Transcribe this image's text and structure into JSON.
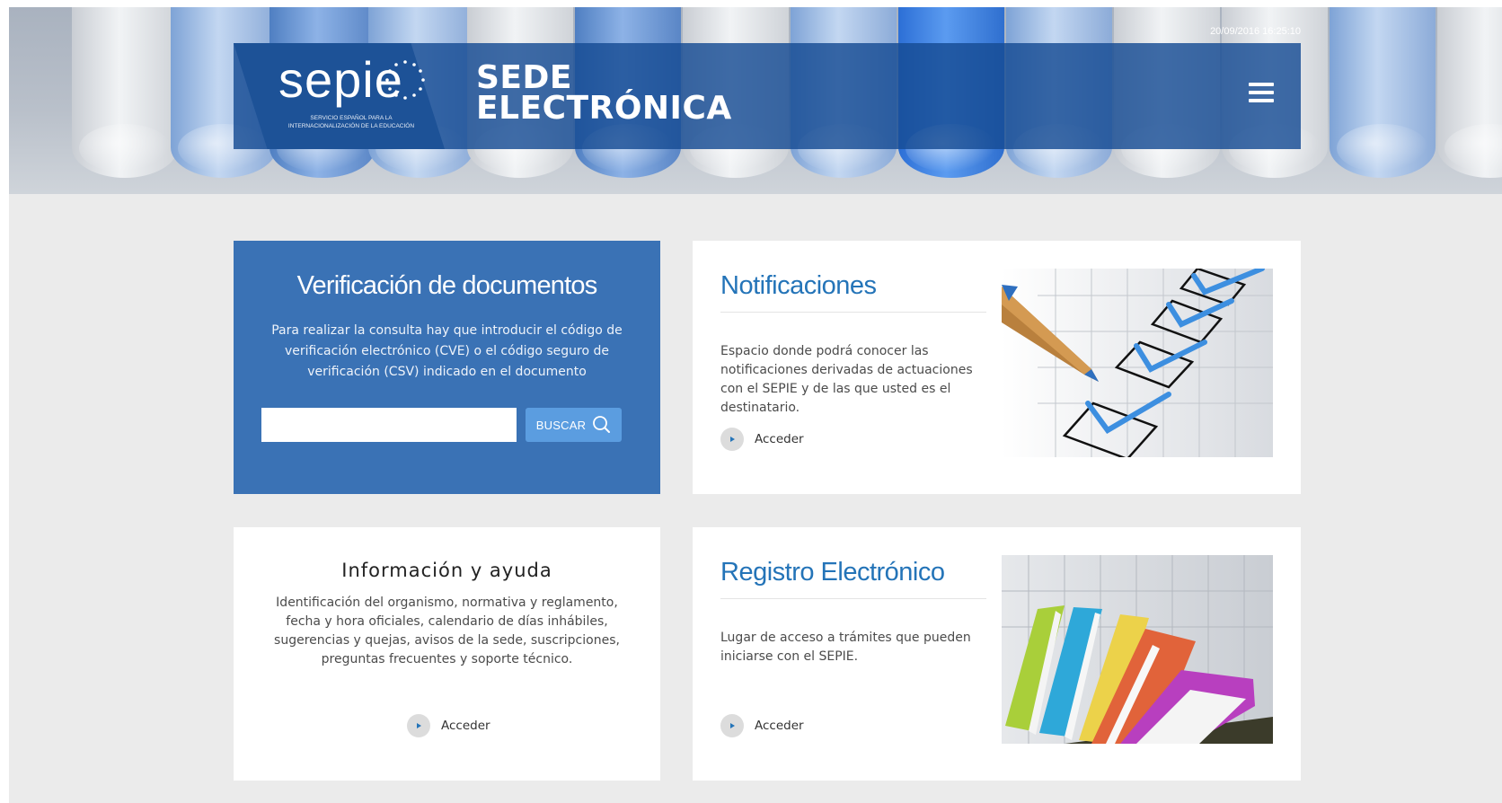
{
  "header": {
    "logo_text": "sepie",
    "logo_subtitle": "SERVICIO ESPAÑOL PARA LA INTERNACIONALIZACIÓN DE LA EDUCACIÓN",
    "title_line1": "SEDE",
    "title_line2": "ELECTRÓNICA",
    "datetime": "20/09/2016 16:25:10",
    "menu_icon": "hamburger-menu-icon"
  },
  "verificacion": {
    "title": "Verificación de documentos",
    "description": "Para realizar la consulta hay que introducir el código de verificación electrónico (CVE) o el código seguro de verificación (CSV) indicado en el documento",
    "input_value": "",
    "button_label": "BUSCAR",
    "button_icon": "search-icon"
  },
  "notificaciones": {
    "title": "Notificaciones",
    "description": "Espacio donde podrá conocer las notificaciones derivadas de actuaciones con el SEPIE y de las que usted es el destinatario.",
    "link_label": "Acceder",
    "image": "checklist-pencil-illustration"
  },
  "informacion": {
    "title": "Información y ayuda",
    "description": "Identificación del organismo, normativa y reglamento, fecha y hora oficiales, calendario de días inhábiles, sugerencias y quejas, avisos de la sede, suscripciones, preguntas frecuentes y soporte técnico.",
    "link_label": "Acceder"
  },
  "registro": {
    "title": "Registro Electrónico",
    "description": "Lugar de acceso a trámites que pueden iniciarse con el SEPIE.",
    "link_label": "Acceder",
    "image": "stacked-books-illustration"
  },
  "colors": {
    "brand_blue": "#3a72b5",
    "header_band": "#164c94",
    "title_blue": "#2474b8",
    "button_blue": "#5b9de0",
    "page_bg": "#ebebeb"
  }
}
